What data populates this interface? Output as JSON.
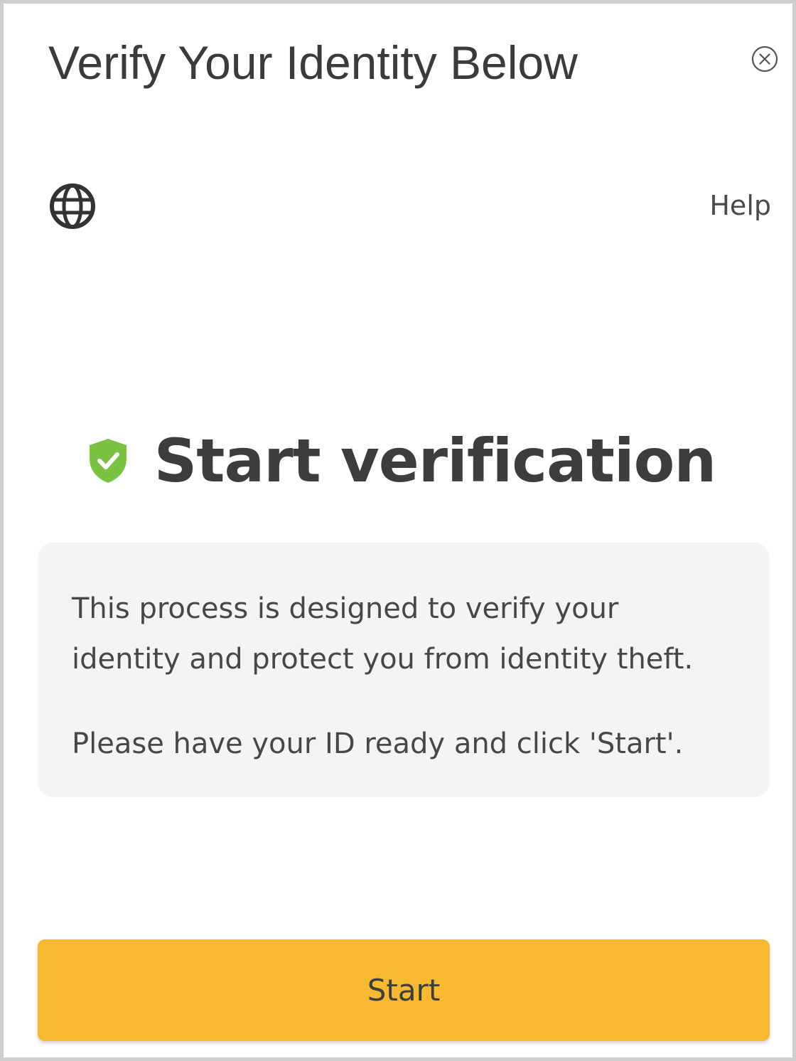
{
  "dialog": {
    "title": "Verify Your Identity Below"
  },
  "toolbar": {
    "language_icon": "globe-icon",
    "help_label": "Help",
    "close_icon": "close-circle-icon"
  },
  "main": {
    "heading": "Start verification",
    "heading_icon": "shield-check-icon",
    "info_paragraphs": [
      "This process is designed to verify your identity and protect you from identity theft.",
      "Please have your ID ready and click 'Start'."
    ],
    "start_label": "Start"
  },
  "colors": {
    "accent": "#f6b930",
    "shield": "#7cc242",
    "info_background": "#f4f4f4",
    "text": "#3d3d3d"
  }
}
